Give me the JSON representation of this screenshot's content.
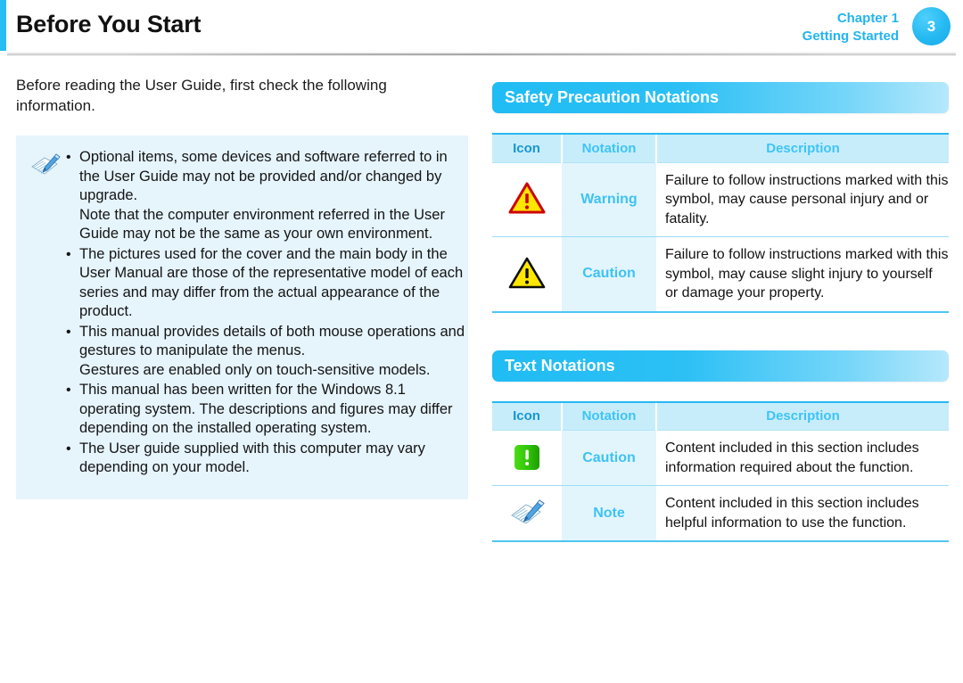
{
  "header": {
    "title": "Before You Start",
    "chapter_line1": "Chapter 1",
    "chapter_line2": "Getting Started",
    "page_number": "3",
    "accent_color": "#26bdf2",
    "chapter_text_color": "#23b4ef"
  },
  "left": {
    "intro": "Before reading the User Guide, first check the following information.",
    "note_icon": "note-pen-paper-icon",
    "bullet_char": "•",
    "notes": [
      {
        "main": "Optional items, some devices and software referred to in the User Guide may not be provided and/or changed by upgrade.",
        "sub": "Note that the computer environment referred in the User Guide may not be the same as your own environment."
      },
      {
        "main": "The pictures used for the cover and the main body in the User Manual are those of the representative model of each series and may differ from the actual appearance of the product.",
        "sub": ""
      },
      {
        "main": "This manual provides details of both mouse operations and gestures to manipulate the menus.",
        "sub": "Gestures are enabled only on touch-sensitive models."
      },
      {
        "main": "This manual has been written for the Windows 8.1 operating system. The descriptions and figures may differ depending on the installed operating system.",
        "sub": ""
      },
      {
        "main": "The User guide supplied with this computer may vary depending on your model.",
        "sub": ""
      }
    ]
  },
  "right": {
    "sections": [
      {
        "title": "Safety Precaution Notations",
        "columns": {
          "icon": "Icon",
          "notation": "Notation",
          "description": "Description"
        },
        "rows": [
          {
            "icon": "warning-triangle-red-icon",
            "notation": "Warning",
            "description": "Failure to follow instructions marked with this symbol, may cause personal injury and or fatality."
          },
          {
            "icon": "caution-triangle-black-icon",
            "notation": "Caution",
            "description": "Failure to follow instructions marked with this symbol, may cause slight injury to yourself or damage your property."
          }
        ]
      },
      {
        "title": "Text Notations",
        "columns": {
          "icon": "Icon",
          "notation": "Notation",
          "description": "Description"
        },
        "rows": [
          {
            "icon": "caution-green-square-icon",
            "notation": "Caution",
            "description": "Content included in this section includes information required about the function."
          },
          {
            "icon": "note-pen-paper-icon",
            "notation": "Note",
            "description": "Content included in this section includes helpful information to use the function."
          }
        ]
      }
    ]
  },
  "colors": {
    "accent_cyan": "#26bdf2",
    "note_box_bg": "#e6f4fc",
    "table_header_bg": "#c7edfb",
    "notation_cell_bg": "#e2f5fd",
    "warning_yellow": "#ffe500",
    "warning_red": "#cc0000",
    "caution_green": "#3cc613"
  }
}
